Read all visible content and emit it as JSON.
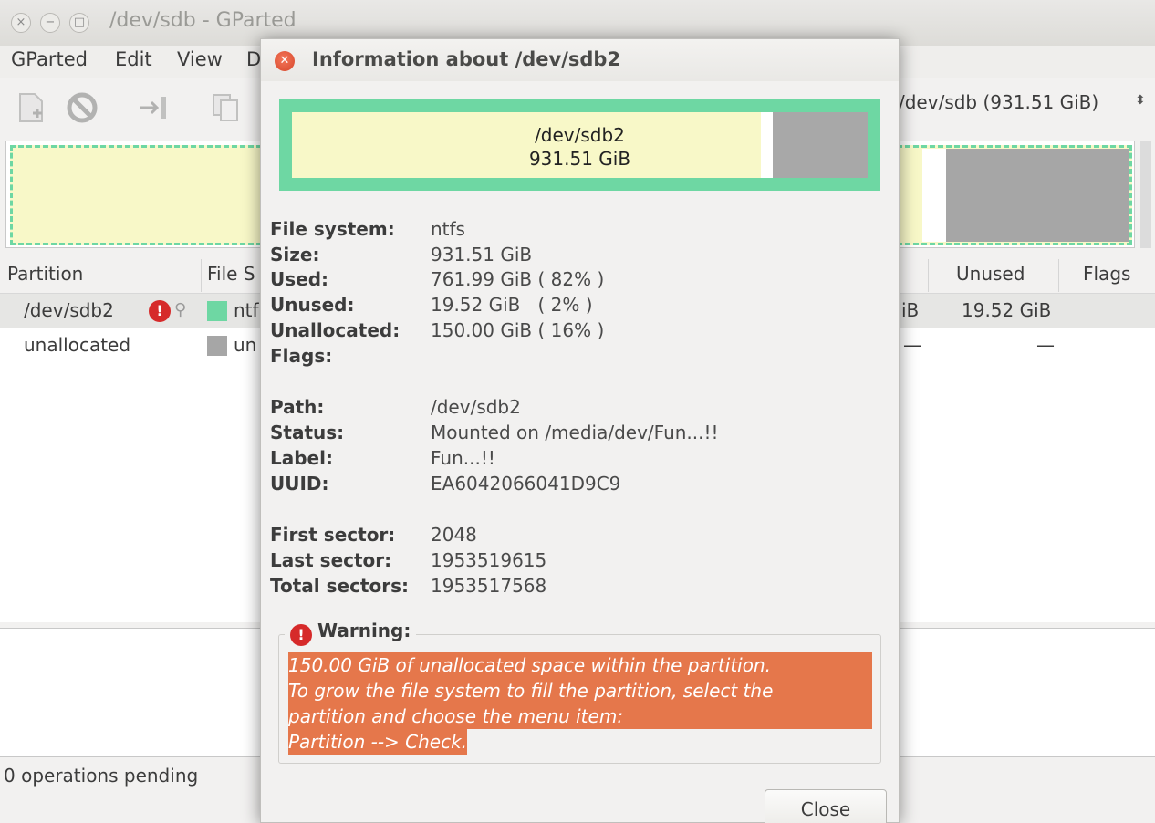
{
  "main_window": {
    "title": "/dev/sdb - GParted",
    "window_buttons": [
      "×",
      "−",
      "□"
    ],
    "menu": [
      "GParted",
      "Edit",
      "View",
      "D"
    ],
    "device_selector": {
      "value": "/dev/sdb  (931.51 GiB)",
      "spin_icon": "⬍"
    },
    "table": {
      "headers": {
        "partition": "Partition",
        "filesystem": "File S",
        "unused": "Unused",
        "flags": "Flags"
      },
      "rows": [
        {
          "partition": "/dev/sdb2",
          "filesystem": "ntf",
          "used_tail": "iB",
          "unused": "19.52 GiB",
          "flags": "",
          "fs_color": "#6ed7a3"
        },
        {
          "partition": "unallocated",
          "filesystem": "un",
          "used_tail": "—",
          "unused": "—",
          "flags": "",
          "fs_color": "#a6a6a6"
        }
      ]
    },
    "status": "0 operations pending"
  },
  "dialog": {
    "title": "Information about /dev/sdb2",
    "bar": {
      "name": "/dev/sdb2",
      "size": "931.51 GiB",
      "used_fraction": 0.82,
      "unused_fraction": 0.02,
      "unallocated_fraction": 0.16
    },
    "details": {
      "file_system": {
        "label": "File system:",
        "value": "ntfs"
      },
      "size": {
        "label": "Size:",
        "value": "931.51 GiB"
      },
      "used": {
        "label": "Used:",
        "value": "761.99 GiB ( 82% )"
      },
      "unused": {
        "label": "Unused:",
        "value": "19.52 GiB   ( 2% )"
      },
      "unallocated": {
        "label": "Unallocated:",
        "value": "150.00 GiB ( 16% )"
      },
      "flags": {
        "label": "Flags:",
        "value": ""
      },
      "path": {
        "label": "Path:",
        "value": "/dev/sdb2"
      },
      "status": {
        "label": "Status:",
        "value": "Mounted on /media/dev/Fun...!!"
      },
      "fs_label": {
        "label": "Label:",
        "value": "Fun...!!"
      },
      "uuid": {
        "label": "UUID:",
        "value": "EA6042066041D9C9"
      },
      "first_sector": {
        "label": "First sector:",
        "value": "2048"
      },
      "last_sector": {
        "label": "Last sector:",
        "value": "1953519615"
      },
      "total_sectors": {
        "label": "Total sectors:",
        "value": "1953517568"
      }
    },
    "warning": {
      "title": "Warning:",
      "lines": [
        "150.00 GiB of unallocated space within the partition.",
        "To grow the file system to fill the partition, select the",
        "partition and choose the menu item:",
        "Partition --> Check."
      ]
    },
    "close_label": "Close"
  },
  "colors": {
    "ntfs": "#6ed7a3",
    "unallocated": "#a6a6a6",
    "used": "#f8f8c8",
    "warning_highlight": "#e5774b",
    "warning_icon": "#d62a2a"
  },
  "icons": [
    "new-icon",
    "delete-icon",
    "resize-icon",
    "copy-icon",
    "warning-icon",
    "key-icon",
    "close-icon",
    "minimize-icon",
    "maximize-icon"
  ]
}
